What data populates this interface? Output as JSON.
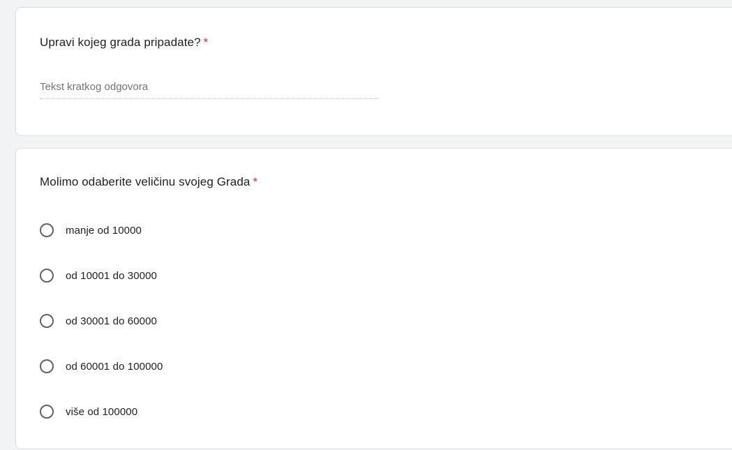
{
  "question1": {
    "title": "Upravi kojeg grada pripadate?",
    "required_marker": "*",
    "input_placeholder": "Tekst kratkog odgovora",
    "input_value": ""
  },
  "question2": {
    "title": "Molimo odaberite veličinu svojeg Grada",
    "required_marker": "*",
    "options": [
      {
        "label": "manje od 10000",
        "selected": false
      },
      {
        "label": "od 10001 do 30000",
        "selected": false
      },
      {
        "label": "od 30001 do 60000",
        "selected": false
      },
      {
        "label": "od 60001 do 100000",
        "selected": false
      },
      {
        "label": "više od 100000",
        "selected": false
      }
    ]
  },
  "colors": {
    "page_background": "#f1f3f4",
    "card_background": "#ffffff",
    "required_star": "#d93025",
    "radio_border": "#5f6368"
  }
}
